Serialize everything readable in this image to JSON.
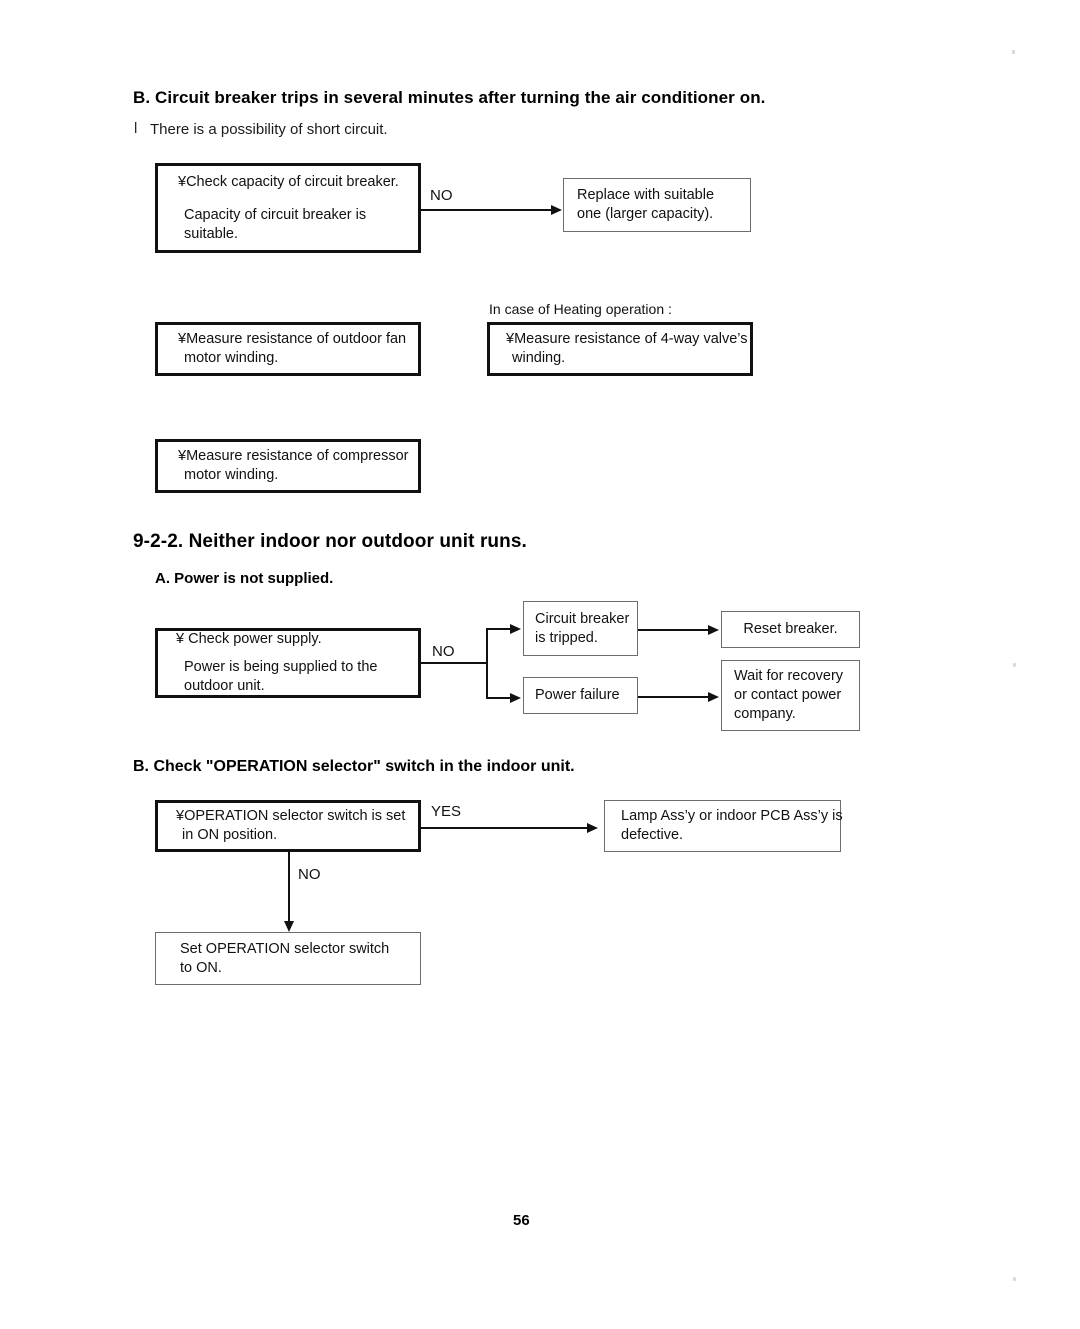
{
  "document": {
    "page_number": "56"
  },
  "section_b_breaker": {
    "heading_label": "B.",
    "heading": "B.  Circuit breaker trips in several minutes after turning the air conditioner on.",
    "bullet_marker": "l",
    "bullet_text": "There is a possibility of short circuit.",
    "flow": {
      "check_box": {
        "line1": "¥Check capacity of circuit breaker.",
        "line2": "Capacity of circuit breaker is",
        "line3": "suitable."
      },
      "branch_label": "NO",
      "result_box": {
        "line1": "Replace with suitable",
        "line2": "one (larger capacity)."
      }
    },
    "measure_boxes": {
      "outdoor_fan": {
        "line1": "¥Measure resistance of outdoor fan",
        "line2": "motor winding."
      },
      "heating_caption": "In case of Heating operation :",
      "four_way_valve": {
        "line1": "¥Measure resistance of 4-way valve’s",
        "line2": "winding."
      },
      "compressor": {
        "line1": "¥Measure resistance of compressor",
        "line2": "motor winding."
      }
    }
  },
  "section_922": {
    "heading": "9-2-2.  Neither indoor nor outdoor unit runs.",
    "sub_a": {
      "heading": "A. Power is not supplied.",
      "check_box": {
        "line1": "¥ Check power supply.",
        "line2": "Power is being supplied to the",
        "line3": "outdoor unit."
      },
      "branch_label": "NO",
      "cause_breaker": {
        "line1": "Circuit breaker",
        "line2": "is tripped."
      },
      "action_breaker": {
        "line1": "Reset breaker."
      },
      "cause_failure": {
        "line1": "Power failure"
      },
      "action_failure": {
        "line1": "Wait for recovery",
        "line2": "or contact power",
        "line3": "company."
      }
    },
    "sub_b": {
      "heading": "B. Check \"OPERATION selector\" switch in the indoor unit.",
      "check_box": {
        "line1": "¥OPERATION selector switch is set",
        "line2": "in ON position."
      },
      "branch_yes": "YES",
      "branch_no": "NO",
      "yes_box": {
        "line1": "Lamp Ass’y or indoor PCB Ass’y is",
        "line2": "defective."
      },
      "no_box": {
        "line1": "Set OPERATION selector switch",
        "line2": "to ON."
      }
    }
  }
}
